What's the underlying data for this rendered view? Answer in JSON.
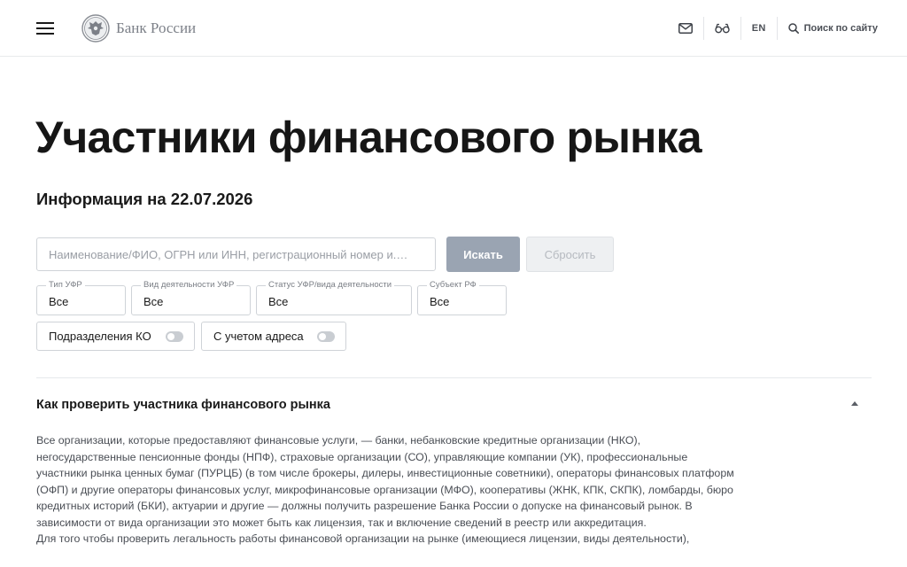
{
  "header": {
    "logo_text": "Банк России",
    "lang_label": "EN",
    "search_label": "Поиск по сайту",
    "icons": [
      "menu-icon",
      "emblem-icon",
      "mail-icon",
      "glasses-icon",
      "search-icon"
    ]
  },
  "main": {
    "title": "Участники финансового рынка",
    "info_date": "Информация на 22.07.2026"
  },
  "search": {
    "placeholder": "Наименование/ФИО, ОГРН или ИНН, регистрационный номер и.…",
    "value": "",
    "find_label": "Искать",
    "reset_label": "Сбросить"
  },
  "filters": [
    {
      "label": "Тип УФР",
      "value": "Все"
    },
    {
      "label": "Вид деятельности УФР",
      "value": "Все"
    },
    {
      "label": "Статус УФР/вида деятельности",
      "value": "Все"
    },
    {
      "label": "Субъект РФ",
      "value": "Все"
    }
  ],
  "toggles": [
    {
      "label": "Подразделения КО",
      "on": false
    },
    {
      "label": "С учетом адреса",
      "on": false
    }
  ],
  "accordion": {
    "title": "Как проверить участника финансового рынка",
    "expanded": true,
    "paragraphs": [
      "Все организации, которые предоставляют финансовые услуги, — банки, небанковские кредитные организации (НКО), негосударственные пенсионные фонды (НПФ), страховые организации (СО), управляющие компании (УК), профессиональные участники рынка ценных бумаг (ПУРЦБ) (в том числе брокеры, дилеры, инвестиционные советники), операторы финансовых платформ (ОФП) и другие операторы финансовых услуг, микрофинансовые организации (МФО), кооперативы (ЖНК, КПК, СКПК), ломбарды, бюро кредитных историй (БКИ), актуарии и другие — должны получить разрешение Банка России о допуске на финансовый рынок. В зависимости от вида организации это может быть как лицензия, так и включение сведений в реестр или аккредитация.",
      "Для того чтобы проверить легальность работы финансовой организации на рынке (имеющиеся лицензии, виды деятельности),"
    ]
  },
  "colors": {
    "primary_button_disabled": "#9aa4b2",
    "secondary_button_bg": "#eef0f2",
    "border": "#cfd3d8",
    "text_muted": "#4a4e55"
  }
}
